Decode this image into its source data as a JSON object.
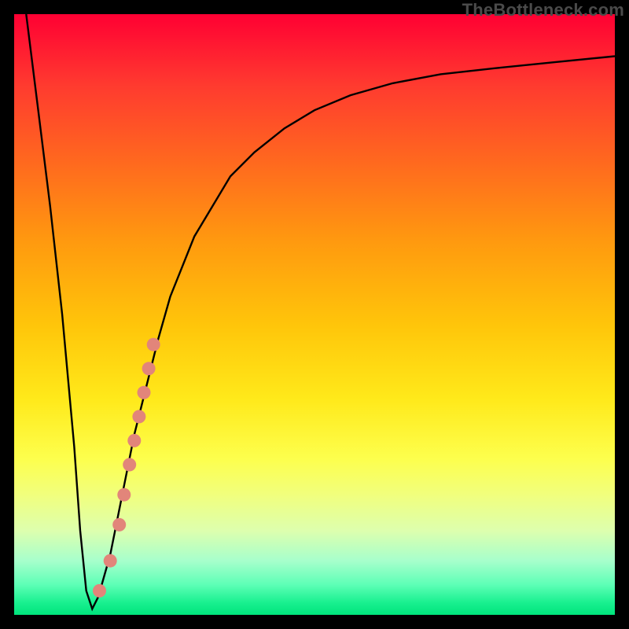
{
  "watermark": "TheBottleneck.com",
  "chart_data": {
    "type": "line",
    "title": "",
    "xlabel": "",
    "ylabel": "",
    "xlim": [
      0,
      100
    ],
    "ylim": [
      0,
      100
    ],
    "series": [
      {
        "name": "curve",
        "x": [
          2,
          4,
          6,
          8,
          10,
          11,
          12,
          13,
          14,
          16,
          18,
          20,
          22,
          24,
          26,
          28,
          30,
          33,
          36,
          40,
          45,
          50,
          56,
          63,
          71,
          80,
          90,
          100
        ],
        "y": [
          100,
          84,
          68,
          50,
          28,
          14,
          4,
          1,
          3,
          10,
          20,
          30,
          38,
          46,
          53,
          58,
          63,
          68,
          73,
          77,
          81,
          84,
          86.5,
          88.5,
          90,
          91,
          92,
          93
        ]
      }
    ],
    "markers": [
      {
        "name": "salmon-dots",
        "color": "#e2857a",
        "points": [
          {
            "x": 14.2,
            "y": 4
          },
          {
            "x": 16.0,
            "y": 9
          },
          {
            "x": 17.5,
            "y": 15
          },
          {
            "x": 18.3,
            "y": 20
          },
          {
            "x": 19.2,
            "y": 25
          },
          {
            "x": 20.0,
            "y": 29
          },
          {
            "x": 20.8,
            "y": 33
          },
          {
            "x": 21.6,
            "y": 37
          },
          {
            "x": 22.4,
            "y": 41
          },
          {
            "x": 23.2,
            "y": 45
          }
        ]
      }
    ],
    "background_gradient": {
      "top": "#ff0033",
      "bottom": "#00e47c"
    }
  }
}
